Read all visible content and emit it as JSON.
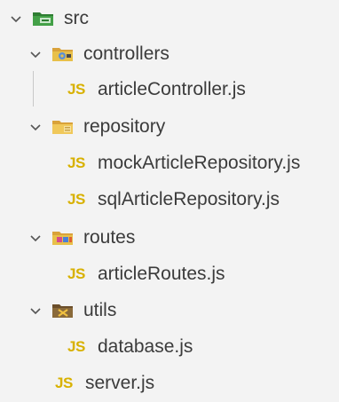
{
  "explorer": {
    "items": [
      {
        "label": "src",
        "type": "folder",
        "icon": "folder-green-icon"
      },
      {
        "label": "controllers",
        "type": "folder",
        "icon": "folder-controllers-icon"
      },
      {
        "label": "articleController.js",
        "type": "file",
        "icon_text": "JS"
      },
      {
        "label": "repository",
        "type": "folder",
        "icon": "folder-repository-icon"
      },
      {
        "label": "mockArticleRepository.js",
        "type": "file",
        "icon_text": "JS"
      },
      {
        "label": "sqlArticleRepository.js",
        "type": "file",
        "icon_text": "JS"
      },
      {
        "label": "routes",
        "type": "folder",
        "icon": "folder-routes-icon"
      },
      {
        "label": "articleRoutes.js",
        "type": "file",
        "icon_text": "JS"
      },
      {
        "label": "utils",
        "type": "folder",
        "icon": "folder-utils-icon"
      },
      {
        "label": "database.js",
        "type": "file",
        "icon_text": "JS"
      },
      {
        "label": "server.js",
        "type": "file",
        "icon_text": "JS"
      }
    ]
  },
  "colors": {
    "background": "#f3f3f3",
    "text": "#3b3b3b",
    "js_icon": "#d8b100",
    "src_folder": "#2e7d32",
    "folder_yellow": "#e8c04a"
  }
}
